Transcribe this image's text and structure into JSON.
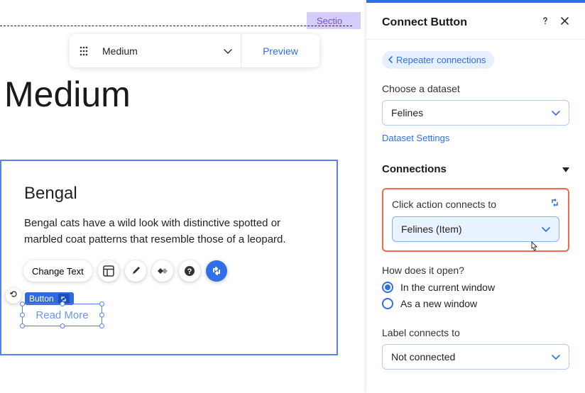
{
  "section_tag": "Sectio",
  "toolbar": {
    "dropdown_value": "Medium",
    "preview_label": "Preview"
  },
  "heading": "Medium",
  "item": {
    "title": "Bengal",
    "description": "Bengal cats have a wild look with distinctive spotted or marbled coat patterns that resemble those of a leopard."
  },
  "actions": {
    "change_text": "Change Text"
  },
  "button_element": {
    "tag_label": "Button",
    "read_more": "Read More"
  },
  "panel": {
    "title": "Connect Button",
    "back_chip": "Repeater connections",
    "choose_dataset_label": "Choose a dataset",
    "dataset_value": "Felines",
    "dataset_settings": "Dataset Settings",
    "connections_heading": "Connections",
    "click_action_label": "Click action connects to",
    "click_action_value": "Felines (Item)",
    "how_open_label": "How does it open?",
    "radio_current": "In the current window",
    "radio_new": "As a new window",
    "label_connects_label": "Label connects to",
    "label_connects_value": "Not connected"
  }
}
